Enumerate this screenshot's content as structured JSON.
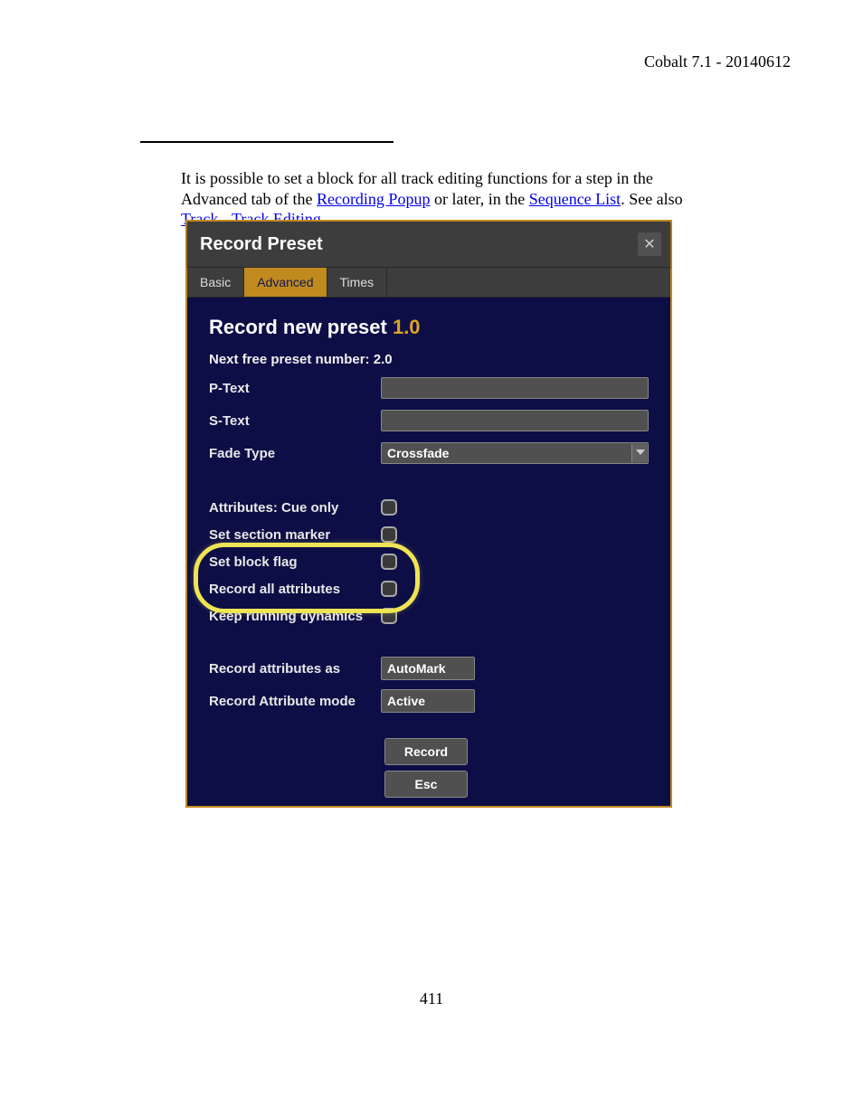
{
  "doc_header": "Cobalt 7.1 - 20140612",
  "body": {
    "pre": "It is possible to set a block for all track editing functions for a step in the Advanced tab of the ",
    "link1": "Recording Popup",
    "mid1": " or later, in the ",
    "link2": "Sequence List",
    "mid2": ". See also ",
    "link3": "Track - Track Editing"
  },
  "dialog": {
    "title": "Record Preset",
    "tabs": {
      "basic": "Basic",
      "advanced": "Advanced",
      "times": "Times"
    },
    "heading_pre": "Record new preset ",
    "heading_num": "1.0",
    "next_free_label": "Next free preset number: ",
    "next_free_val": "2.0",
    "rows": {
      "ptext": "P-Text",
      "stext": "S-Text",
      "fadetype": "Fade Type",
      "fadetype_val": "Crossfade"
    },
    "checks": {
      "cueonly": "Attributes: Cue only",
      "section": "Set section marker",
      "block": "Set block flag",
      "recall": "Record all attributes",
      "keeprun": "Keep running dynamics"
    },
    "selects": {
      "recas_label": "Record attributes as",
      "recas_val": "AutoMark",
      "recmode_label": "Record Attribute mode",
      "recmode_val": "Active"
    },
    "buttons": {
      "record": "Record",
      "esc": "Esc"
    }
  },
  "page_number": "411"
}
